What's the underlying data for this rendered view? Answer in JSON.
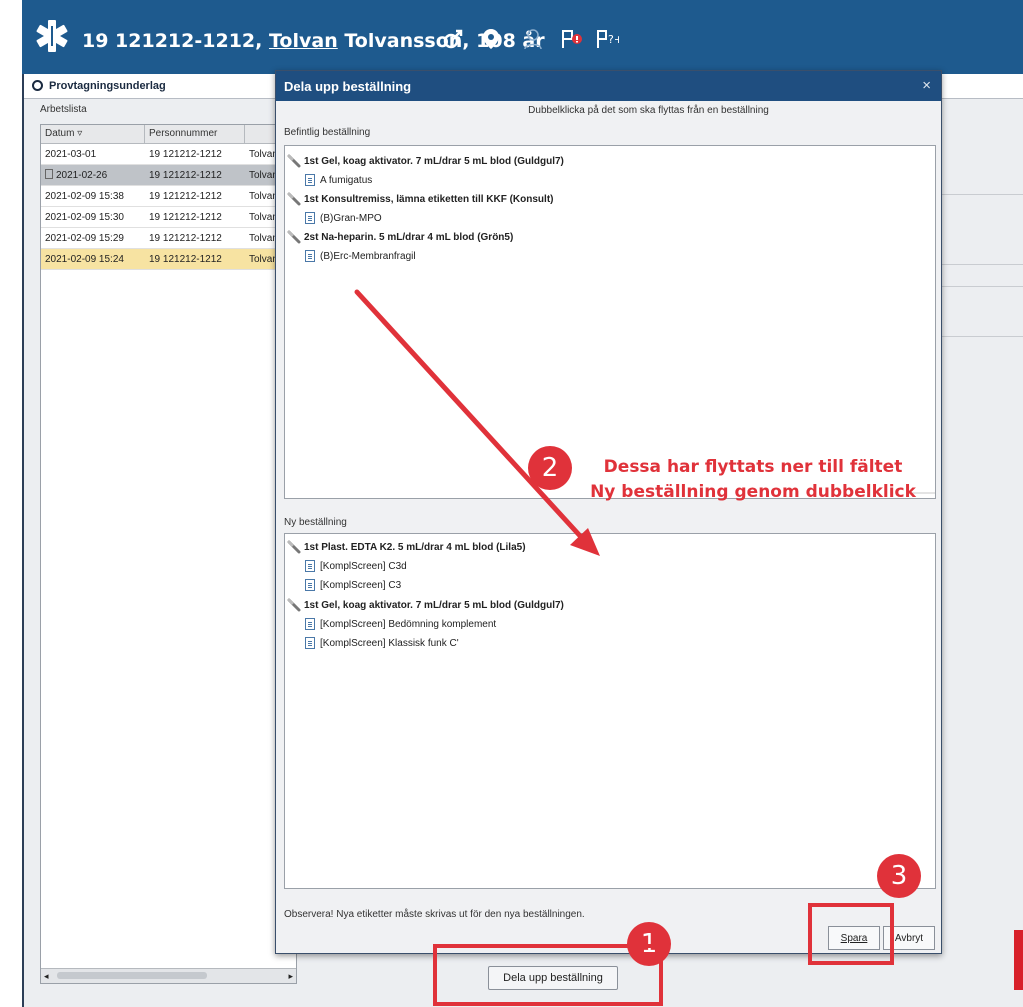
{
  "banner": {
    "personnummer": "19 121212-1212,",
    "first_name": "Tolvan",
    "last_name_age": "Tolvansson, 108 år"
  },
  "subbar": {
    "title": "Provtagningsunderlag"
  },
  "worklist": {
    "label": "Arbetslista",
    "headers": [
      "Datum",
      "Personnummer"
    ],
    "rows": [
      {
        "datum": "2021-03-01",
        "pnr": "19 121212-1212",
        "name": "Tolvan"
      },
      {
        "datum": "2021-02-26",
        "pnr": "19 121212-1212",
        "name": "Tolvan"
      },
      {
        "datum": "2021-02-09 15:38",
        "pnr": "19 121212-1212",
        "name": "Tolvan"
      },
      {
        "datum": "2021-02-09 15:30",
        "pnr": "19 121212-1212",
        "name": "Tolvan"
      },
      {
        "datum": "2021-02-09 15:29",
        "pnr": "19 121212-1212",
        "name": "Tolvan"
      },
      {
        "datum": "2021-02-09 15:24",
        "pnr": "19 121212-1212",
        "name": "Tolvan"
      }
    ]
  },
  "dialog": {
    "title": "Dela upp beställning",
    "close": "×",
    "instruction": "Dubbelklicka på det som ska flyttas från en beställning",
    "existing_label": "Befintlig beställning",
    "existing_items": [
      {
        "type": "group",
        "text": "1st Gel, koag aktivator. 7 mL/drar 5 mL blod (Guldgul7)"
      },
      {
        "type": "analysis",
        "text": "A fumigatus"
      },
      {
        "type": "group",
        "text": "1st Konsultremiss, lämna etiketten till KKF (Konsult)"
      },
      {
        "type": "analysis",
        "text": "(B)Gran-MPO"
      },
      {
        "type": "group",
        "text": "2st Na-heparin. 5 mL/drar 4 mL blod (Grön5)"
      },
      {
        "type": "analysis",
        "text": "(B)Erc-Membranfragil"
      }
    ],
    "new_label": "Ny beställning",
    "new_items": [
      {
        "type": "group",
        "text": "1st Plast. EDTA K2. 5 mL/drar 4 mL blod (Lila5)"
      },
      {
        "type": "analysis",
        "text": "[KomplScreen] C3d"
      },
      {
        "type": "analysis",
        "text": "[KomplScreen] C3"
      },
      {
        "type": "group",
        "text": "1st Gel, koag aktivator. 7 mL/drar 5 mL blod (Guldgul7)"
      },
      {
        "type": "analysis",
        "text": "[KomplScreen] Bedömning komplement"
      },
      {
        "type": "analysis",
        "text": "[KomplScreen] Klassisk funk C'"
      }
    ],
    "note": "Observera! Nya etiketter måste skrivas ut för den nya beställningen.",
    "save": "Spara",
    "cancel": "Avbryt"
  },
  "split_button": "Dela upp beställning",
  "annotations": {
    "badge1": "1",
    "badge2": "2",
    "badge3": "3",
    "text_line1": "Dessa har flyttats ner till fältet",
    "text_line2": "Ny beställning genom dubbelklick",
    "color": "#e0323a"
  },
  "colors": {
    "banner": "#1e5a8e",
    "dialog_title": "#1f4e80",
    "highlight_row": "#f7e3a2"
  }
}
